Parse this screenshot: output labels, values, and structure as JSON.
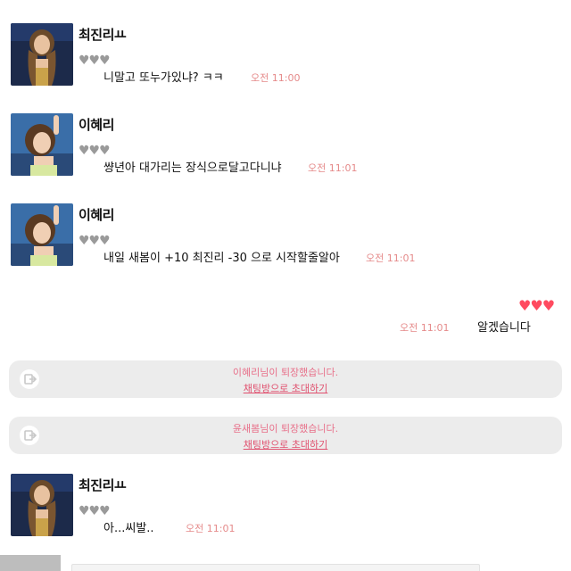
{
  "messages": [
    {
      "sender": "최진리ㅛ",
      "hearts": "♥♥♥",
      "text": "니말고 또누가있냐? ㅋㅋ",
      "time": "오전 11:00"
    },
    {
      "sender": "이혜리",
      "hearts": "♥♥♥",
      "text": "썅년아 대가리는 장식으로달고다니냐",
      "time": "오전 11:01"
    },
    {
      "sender": "이혜리",
      "hearts": "♥♥♥",
      "text": "내일 새봄이 +10 최진리 -30 으로 시작할줄알아",
      "time": "오전 11:01"
    },
    {
      "sender": "최진리ㅛ",
      "hearts": "♥♥♥",
      "text": "아...씨발..",
      "time": "오전 11:01"
    }
  ],
  "my_message": {
    "hearts": "♥♥♥",
    "text": "알겠습니다",
    "time": "오전 11:01"
  },
  "notices": [
    {
      "text": "이혜리님이 퇴장했습니다.",
      "link": "채팅방으로 초대하기"
    },
    {
      "text": "윤새봄님이 퇴장했습니다.",
      "link": "채팅방으로 초대하기"
    }
  ],
  "colors": {
    "time": "#e58a8a",
    "my_hearts": "#ff4a5f",
    "other_hearts": "#9a9a9a",
    "notice_bg": "#ececec",
    "notice_text": "#e8708a"
  }
}
